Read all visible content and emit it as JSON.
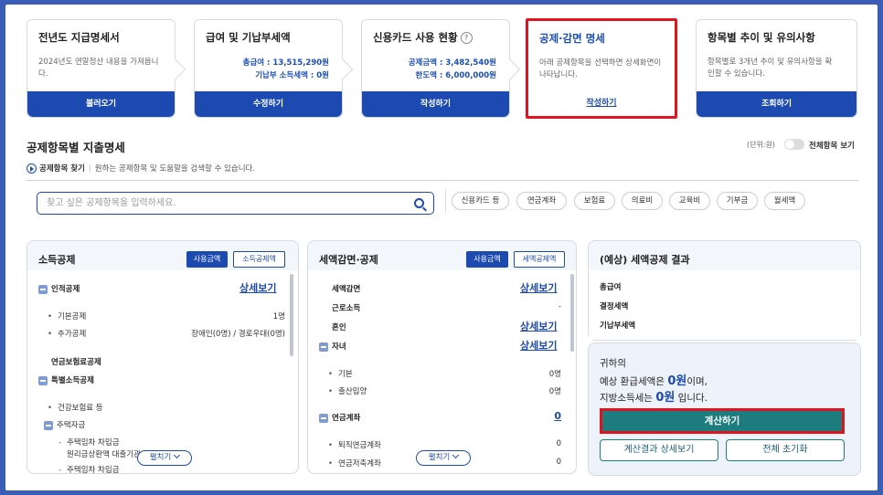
{
  "steps": [
    {
      "title": "전년도 지급명세서",
      "desc": "2024년도 연말정산 내용을 가져옵니다.",
      "button": "불러오기"
    },
    {
      "title": "급여 및 기납부세액",
      "line1": "총급여 : 13,515,290원",
      "line2": "기납부 소득세액 : 0원",
      "button": "수정하기"
    },
    {
      "title": "신용카드 사용 현황",
      "help": "?",
      "line1": "공제금액 : 3,482,540원",
      "line2": "한도액 : 6,000,000원",
      "button": "작성하기"
    },
    {
      "title": "공제·감면 명세",
      "desc": "아래 공제항목을 선택하면 상세화면이 나타납니다.",
      "button": "작성하기"
    },
    {
      "title": "항목별 추이 및 유의사항",
      "desc": "항목별로 3개년 추이 및 유의사항을 확인할 수 있습니다.",
      "button": "조회하기"
    }
  ],
  "section_title": "공제항목별 지출명세",
  "unit_label": "(단위:원)",
  "toggle_label": "전체항목 보기",
  "find": {
    "label": "공제항목 찾기",
    "hint": "원하는 공제항목 및 도움말을 검색할 수 있습니다."
  },
  "search": {
    "placeholder": "찾고 싶은 공제항목을 입력하세요."
  },
  "chips": [
    "신용카드 등",
    "연금계좌",
    "보험료",
    "의료비",
    "교육비",
    "기부금",
    "월세액"
  ],
  "income_panel": {
    "title": "소득공제",
    "tab_on": "사용금액",
    "tab_off": "소득공제액",
    "personal": "인적공제",
    "detail": "상세보기",
    "basic": "기본공제",
    "basic_val": "1명",
    "extra": "추가공제",
    "extra_val": "장애인(0명) / 경로우대(0명)",
    "pension_ins": "연금보험료공제",
    "special": "특별소득공제",
    "health": "건강보험료 등",
    "housing": "주택자금",
    "loan1": "주택임차 차입금",
    "loan1b": "원리금상환액 대출기관",
    "loan2": "주택임차 차입금",
    "fold": "펼치기"
  },
  "tax_panel": {
    "title": "세액감면·공제",
    "tab_on": "사용금액",
    "tab_off": "세액공제액",
    "reduction": "세액감면",
    "reduction_link": "상세보기",
    "earned": "근로소득",
    "earned_val": "-",
    "marriage": "혼인",
    "marriage_link": "상세보기",
    "children": "자녀",
    "children_link": "상세보기",
    "basic": "기본",
    "basic_val": "0명",
    "birth": "출산입양",
    "birth_val": "0명",
    "pension": "연금계좌",
    "pension_val": "0",
    "retire": "퇴직연금계좌",
    "retire_val": "0",
    "saving": "연금저축계좌",
    "saving_val": "0",
    "fold": "펼치기"
  },
  "result_panel": {
    "title": "(예상) 세액공제 결과",
    "total_pay": "총급여",
    "decided_tax": "결정세액",
    "prepaid_tax": "기납부세액",
    "line1": "귀하의",
    "line2_pre": "예상 환급세액은",
    "line2_val": "0원",
    "line2_post": "이며,",
    "line3_pre": "지방소득세는",
    "line3_val": "0원",
    "line3_post": "입니다.",
    "calc_button": "계산하기",
    "detail_button": "계산결과 상세보기",
    "reset_button": "전체 초기화"
  }
}
